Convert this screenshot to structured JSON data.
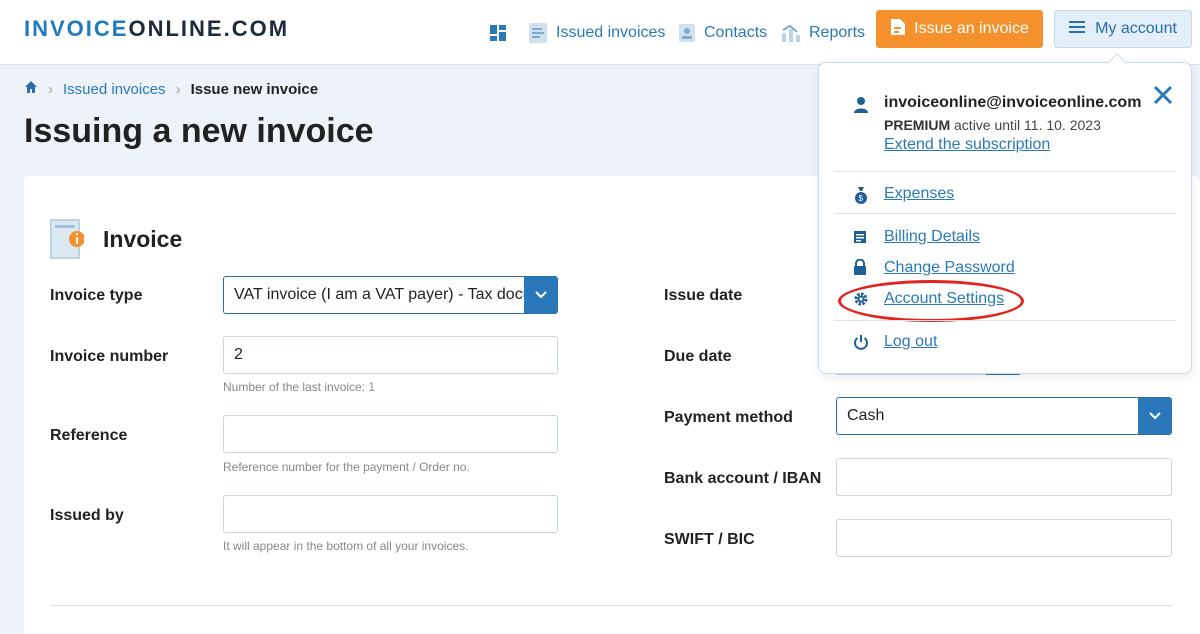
{
  "header": {
    "logo_part1": "INVOICE",
    "logo_part2": "ONLINE.COM",
    "nav": {
      "dashboard_icon": "grid-icon",
      "issued_invoices": "Issued invoices",
      "contacts": "Contacts",
      "reports": "Reports"
    },
    "issue_button": "Issue an invoice",
    "account_button": "My account"
  },
  "breadcrumb": {
    "home_icon": "home-icon",
    "link": "Issued invoices",
    "current": "Issue new invoice"
  },
  "page_title": "Issuing a new invoice",
  "invoice_section": {
    "title": "Invoice",
    "fields": {
      "invoice_type": {
        "label": "Invoice type",
        "value": "VAT invoice (I am a VAT payer) - Tax document"
      },
      "invoice_number": {
        "label": "Invoice number",
        "value": "2",
        "hint": "Number of the last invoice: 1"
      },
      "reference": {
        "label": "Reference",
        "value": "",
        "hint": "Reference number for the payment / Order no."
      },
      "issued_by": {
        "label": "Issued by",
        "value": "",
        "hint": "It will appear in the bottom of all your invoices."
      },
      "issue_date": {
        "label": "Issue date"
      },
      "due_date": {
        "label": "Due date"
      },
      "payment_method": {
        "label": "Payment method",
        "value": "Cash"
      },
      "bank_account": {
        "label": "Bank account / IBAN",
        "value": ""
      },
      "swift": {
        "label": "SWIFT / BIC",
        "value": ""
      }
    }
  },
  "account_menu": {
    "email": "invoiceonline@invoiceonline.com",
    "plan": "PREMIUM",
    "plan_status": "active until 11. 10. 2023",
    "extend": "Extend the subscription",
    "expenses": "Expenses",
    "billing_details": "Billing Details",
    "change_password": "Change Password",
    "account_settings": "Account Settings",
    "log_out": "Log out"
  },
  "colors": {
    "accent": "#2a78b9",
    "orange": "#f5912d",
    "highlight": "#e2261f"
  }
}
